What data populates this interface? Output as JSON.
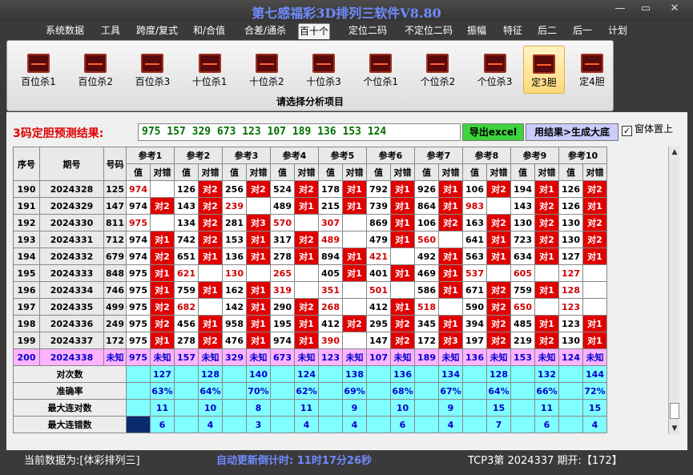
{
  "window": {
    "title": "第七感福彩3D排列三软件V8.80",
    "minimize": "—",
    "restore": "▭",
    "close": "✕"
  },
  "menu": [
    "系统数据",
    "工具",
    "跨度/复式",
    "和/合值",
    "合差/通杀",
    "百十个",
    "定位二码",
    "不定位二码",
    "振幅",
    "特征",
    "后二",
    "后一",
    "计划"
  ],
  "menu_active": 5,
  "ribbon": {
    "buttons": [
      "百位杀1",
      "百位杀2",
      "百位杀3",
      "十位杀1",
      "十位杀2",
      "十位杀3",
      "个位杀1",
      "个位杀2",
      "个位杀3",
      "定3胆",
      "定4胆"
    ],
    "active": 9,
    "caption": "请选择分析项目"
  },
  "prediction": {
    "label": "3码定胆预测结果:",
    "value": "975 157 329 673 123 107 189 136 153 124",
    "excel_button": "导出excel",
    "gen_button": "用结果>生成大底",
    "top_checkbox": "窗体置上",
    "top_checked": "✓"
  },
  "table": {
    "headers": {
      "seq": "序号",
      "period": "期号",
      "number": "号码",
      "value": "值",
      "hit": "对错"
    },
    "refs": [
      "参考1",
      "参考2",
      "参考3",
      "参考4",
      "参考5",
      "参考6",
      "参考7",
      "参考8",
      "参考9",
      "参考10"
    ],
    "rows": [
      {
        "seq": "190",
        "period": "2024328",
        "number": "125",
        "cells": [
          [
            "974",
            ""
          ],
          [
            "126",
            "对2"
          ],
          [
            "256",
            "对2"
          ],
          [
            "524",
            "对2"
          ],
          [
            "178",
            "对1"
          ],
          [
            "792",
            "对1"
          ],
          [
            "926",
            "对1"
          ],
          [
            "106",
            "对2"
          ],
          [
            "194",
            "对1"
          ],
          [
            "126",
            "对2"
          ]
        ]
      },
      {
        "seq": "191",
        "period": "2024329",
        "number": "147",
        "cells": [
          [
            "974",
            "对2"
          ],
          [
            "143",
            "对2"
          ],
          [
            "239",
            ""
          ],
          [
            "489",
            "对1"
          ],
          [
            "215",
            "对1"
          ],
          [
            "739",
            "对1"
          ],
          [
            "864",
            "对1"
          ],
          [
            "983",
            ""
          ],
          [
            "143",
            "对2"
          ],
          [
            "126",
            "对1"
          ]
        ]
      },
      {
        "seq": "192",
        "period": "2024330",
        "number": "811",
        "cells": [
          [
            "975",
            ""
          ],
          [
            "134",
            "对2"
          ],
          [
            "281",
            "对3"
          ],
          [
            "570",
            ""
          ],
          [
            "307",
            ""
          ],
          [
            "869",
            "对1"
          ],
          [
            "106",
            "对2"
          ],
          [
            "163",
            "对2"
          ],
          [
            "130",
            "对2"
          ],
          [
            "130",
            "对2"
          ]
        ]
      },
      {
        "seq": "193",
        "period": "2024331",
        "number": "712",
        "cells": [
          [
            "974",
            "对1"
          ],
          [
            "742",
            "对2"
          ],
          [
            "153",
            "对1"
          ],
          [
            "317",
            "对2"
          ],
          [
            "489",
            ""
          ],
          [
            "479",
            "对1"
          ],
          [
            "560",
            ""
          ],
          [
            "641",
            "对1"
          ],
          [
            "723",
            "对2"
          ],
          [
            "130",
            "对2"
          ]
        ]
      },
      {
        "seq": "194",
        "period": "2024332",
        "number": "679",
        "cells": [
          [
            "974",
            "对2"
          ],
          [
            "651",
            "对1"
          ],
          [
            "136",
            "对1"
          ],
          [
            "278",
            "对1"
          ],
          [
            "894",
            "对1"
          ],
          [
            "421",
            ""
          ],
          [
            "492",
            "对1"
          ],
          [
            "563",
            "对1"
          ],
          [
            "634",
            "对1"
          ],
          [
            "127",
            "对1"
          ]
        ]
      },
      {
        "seq": "195",
        "period": "2024333",
        "number": "848",
        "cells": [
          [
            "975",
            "对1"
          ],
          [
            "621",
            ""
          ],
          [
            "130",
            ""
          ],
          [
            "265",
            ""
          ],
          [
            "405",
            "对1"
          ],
          [
            "401",
            "对1"
          ],
          [
            "469",
            "对1"
          ],
          [
            "537",
            ""
          ],
          [
            "605",
            ""
          ],
          [
            "127",
            ""
          ]
        ]
      },
      {
        "seq": "196",
        "period": "2024334",
        "number": "746",
        "cells": [
          [
            "975",
            "对1"
          ],
          [
            "759",
            "对1"
          ],
          [
            "162",
            "对1"
          ],
          [
            "319",
            ""
          ],
          [
            "351",
            ""
          ],
          [
            "501",
            ""
          ],
          [
            "586",
            "对1"
          ],
          [
            "671",
            "对2"
          ],
          [
            "759",
            "对1"
          ],
          [
            "128",
            ""
          ]
        ]
      },
      {
        "seq": "197",
        "period": "2024335",
        "number": "499",
        "cells": [
          [
            "975",
            "对2"
          ],
          [
            "682",
            ""
          ],
          [
            "142",
            "对1"
          ],
          [
            "290",
            "对2"
          ],
          [
            "268",
            ""
          ],
          [
            "412",
            "对1"
          ],
          [
            "518",
            ""
          ],
          [
            "590",
            "对2"
          ],
          [
            "650",
            ""
          ],
          [
            "123",
            ""
          ]
        ]
      },
      {
        "seq": "198",
        "period": "2024336",
        "number": "249",
        "cells": [
          [
            "975",
            "对2"
          ],
          [
            "456",
            "对1"
          ],
          [
            "958",
            "对1"
          ],
          [
            "195",
            "对1"
          ],
          [
            "412",
            "对2"
          ],
          [
            "295",
            "对2"
          ],
          [
            "345",
            "对1"
          ],
          [
            "394",
            "对2"
          ],
          [
            "485",
            "对1"
          ],
          [
            "123",
            "对1"
          ]
        ]
      },
      {
        "seq": "199",
        "period": "2024337",
        "number": "172",
        "cells": [
          [
            "975",
            "对1"
          ],
          [
            "278",
            "对2"
          ],
          [
            "476",
            "对1"
          ],
          [
            "974",
            "对1"
          ],
          [
            "390",
            ""
          ],
          [
            "147",
            "对2"
          ],
          [
            "172",
            "对3"
          ],
          [
            "197",
            "对2"
          ],
          [
            "219",
            "对2"
          ],
          [
            "130",
            "对1"
          ]
        ]
      }
    ],
    "pred_row": {
      "seq": "200",
      "period": "2024338",
      "number": "未知",
      "values": [
        "975",
        "157",
        "329",
        "673",
        "123",
        "107",
        "189",
        "136",
        "153",
        "124"
      ],
      "unknown": "未知"
    },
    "stats": [
      {
        "label": "对次数",
        "values": [
          "127",
          "128",
          "140",
          "124",
          "138",
          "136",
          "134",
          "128",
          "132",
          "144"
        ]
      },
      {
        "label": "准确率",
        "values": [
          "63%",
          "64%",
          "70%",
          "62%",
          "69%",
          "68%",
          "67%",
          "64%",
          "66%",
          "72%"
        ]
      },
      {
        "label": "最大连对数",
        "values": [
          "11",
          "10",
          "8",
          "11",
          "9",
          "10",
          "9",
          "15",
          "11",
          "15"
        ]
      },
      {
        "label": "最大连错数",
        "values": [
          "6",
          "4",
          "3",
          "4",
          "4",
          "6",
          "4",
          "7",
          "6",
          "4"
        ]
      }
    ]
  },
  "scrollbar": {
    "up": "▲",
    "down": "▼"
  },
  "status": {
    "left": "当前数据为:[体彩排列三]",
    "countdown": "自动更新倒计时: 11时17分26秒",
    "right": "TCP3第 2024337 期开:【172】"
  },
  "colors": {
    "hit_bg": "#e00000",
    "pred_bg": "#ffb3ff",
    "stat_bg": "#7fffff",
    "title": "#6f8cff"
  }
}
